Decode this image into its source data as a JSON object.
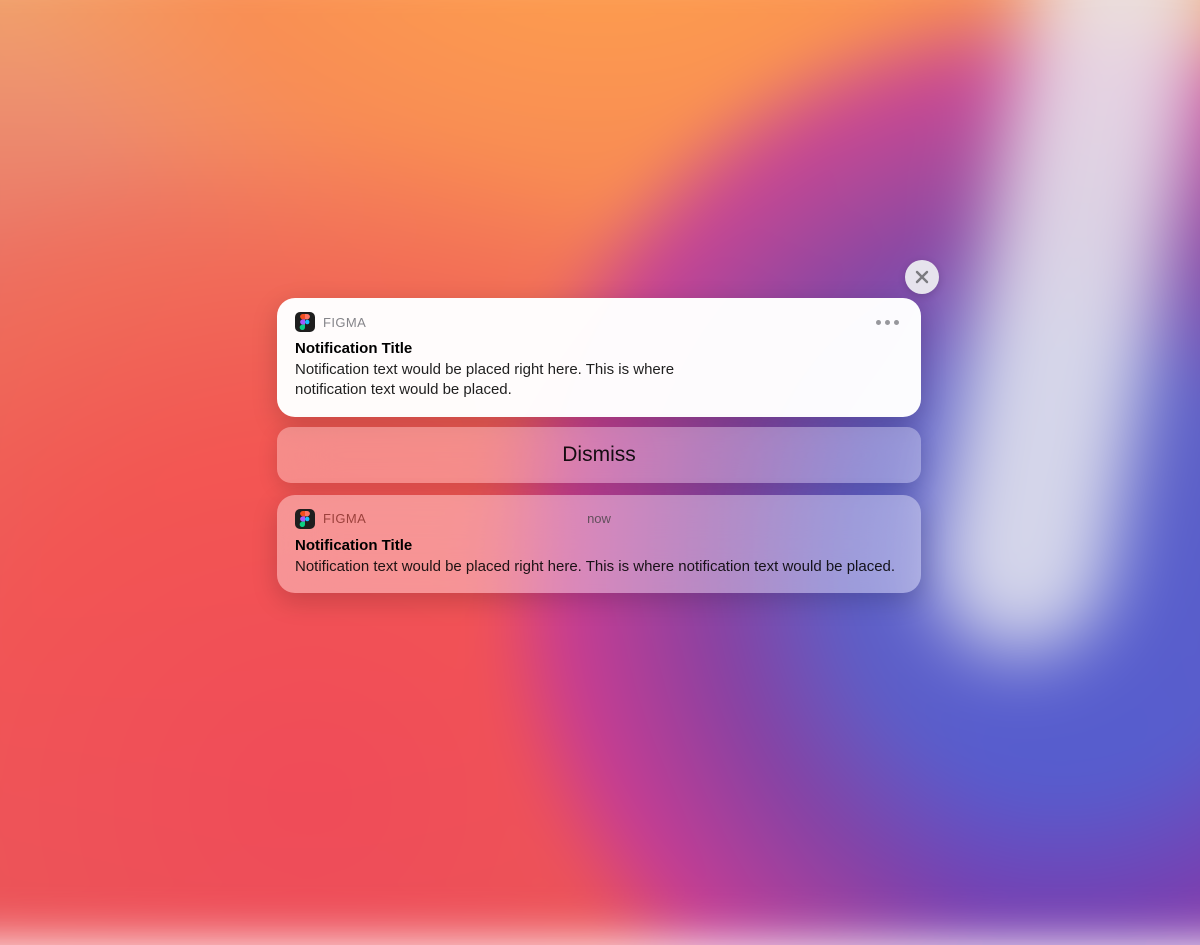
{
  "notifications": [
    {
      "app_name": "FIGMA",
      "title": "Notification Title",
      "body": "Notification text would be placed right here. This is where notification text would be placed."
    },
    {
      "app_name": "FIGMA",
      "timestamp": "now",
      "title": "Notification Title",
      "body": "Notification text would be placed right here. This is where notification text would be placed."
    }
  ],
  "dismiss_label": "Dismiss"
}
